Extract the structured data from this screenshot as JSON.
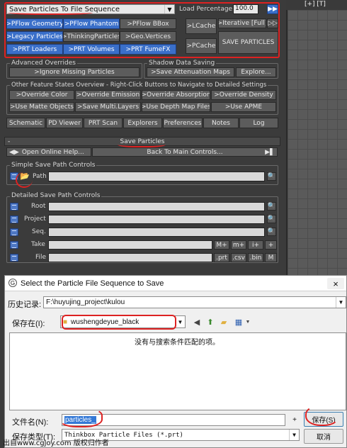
{
  "top": {
    "save_mode_value": "Save Particles To File Sequence",
    "load_percentage_label": "Load Percentage:",
    "load_percentage_value": "100.0",
    "row1": [
      ">PFlow Geometry",
      ">PFlow Phantom",
      ">PFlow BBox"
    ],
    "row2": [
      ">Legacy Particles",
      ">ThinkingParticles",
      ">Geo.Vertices"
    ],
    "row3": [
      ">PRT Loaders",
      ">PRT Volumes",
      ">PRT FumeFX"
    ],
    "lcache": ">LCache",
    "pcache": ">PCache",
    "iterative": ">Iterative [Full]",
    "save_particles_top": "SAVE PARTICLES",
    "ff_icon": "double-arrow-icon"
  },
  "overrides": {
    "advanced_title": "Advanced Overrides",
    "ignore_missing": ">Ignore Missing Particles",
    "shadow_title": "Shadow Data Saving",
    "save_attenuation": ">Save Attenuation Maps",
    "explore": "Explore..."
  },
  "other": {
    "title": "Other Feature States Overview - Right-Click Buttons to Navigate to Detailed Settings",
    "row1": [
      ">Override Color",
      ">Override Emission",
      ">Override Absorption",
      ">Override Density"
    ],
    "row2": [
      ">Use Matte Objects",
      ">Save Multi.Layers",
      ">Use Depth Map Files",
      ">Use APME"
    ]
  },
  "tabs": [
    "Schematic",
    "PD Viewer",
    "PRT Scan",
    "Explorers",
    "Preferences",
    "Notes",
    "Log"
  ],
  "rollout": {
    "minus": "-",
    "title": "Save Particles",
    "open_help": "Open Online Help...",
    "back_to_main": "Back To Main Controls..."
  },
  "simple": {
    "title": "Simple Save Path Controls",
    "path_label": "Path"
  },
  "detailed": {
    "title": "Detailed Save Path Controls",
    "rows": [
      "Root",
      "Project",
      "Seq.",
      "Take",
      "File"
    ],
    "take_buttons": [
      "M+",
      "m+",
      "i+",
      "+"
    ],
    "file_buttons": [
      ".prt",
      ".csv",
      ".bin",
      "M"
    ]
  },
  "dialog": {
    "title": "Select the Particle File Sequence to Save",
    "close": "×",
    "history_label": "历史记录:",
    "history_value": "F:\\huyujing_project\\kulou",
    "save_in_label": "保存在(I):",
    "save_in_value": "wushengdeyue_black",
    "empty_message": "没有与搜索条件匹配的项。",
    "filename_label": "文件名(N):",
    "filename_value": "particles_",
    "plus": "+",
    "save_button": "保存(S)",
    "filetype_label": "保存类型(T):",
    "filetype_value": "Thinkbox Particle Files (*.prt)",
    "cancel_button": "取消",
    "watermark": "出自www.cgjoy.com 版权归作者"
  },
  "viewport": {
    "label": "[+] [T]"
  },
  "colors": {
    "accent_blue": "#3a6fc9",
    "annotation_red": "#dd2222",
    "panel_bg": "#3b3b3b"
  }
}
